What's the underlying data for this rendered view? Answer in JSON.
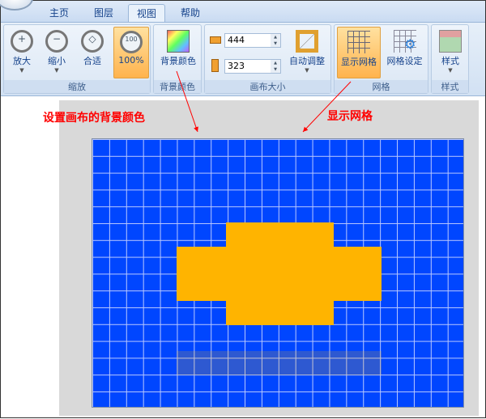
{
  "tabs": [
    "主页",
    "图层",
    "视图",
    "帮助"
  ],
  "zoom": {
    "zoom_in": "放大",
    "zoom_out": "缩小",
    "fit": "合适",
    "actual": "100%",
    "actual_icon_text": "100",
    "group": "缩放"
  },
  "bg": {
    "label": "背景颜色",
    "group": "背景颜色"
  },
  "size": {
    "width": "444",
    "height": "323",
    "auto": "自动调整",
    "group": "画布大小"
  },
  "grid": {
    "show": "显示网格",
    "settings": "网格设定",
    "group": "网格"
  },
  "style": {
    "label": "样式",
    "group": "样式"
  },
  "annotations": {
    "bg": "设置画布的背景颜色",
    "grid": "显示网格"
  },
  "colors": {
    "canvas": "#0046ff",
    "shape": "#ffb400",
    "annotation": "#ff0000"
  }
}
